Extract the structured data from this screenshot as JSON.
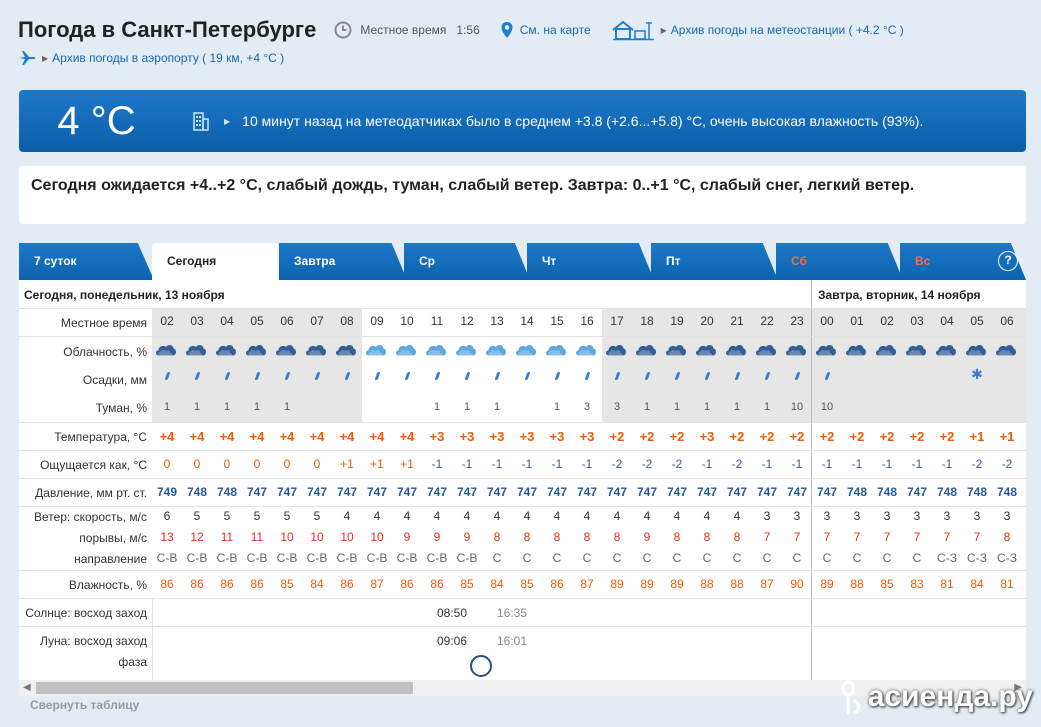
{
  "header": {
    "title": "Погода в Санкт-Петербурге",
    "local_time_label": "Местное время",
    "local_time": "1:56",
    "map_link": "См. на карте",
    "station_archive": "Архив погоды на метеостанции ( +4.2 °C )",
    "airport_archive": "Архив погоды в аэропорту ( 19 км, +4 °C )"
  },
  "now": {
    "temp": "4 °C",
    "message": "10 минут назад на метеодатчиках было в среднем +3.8 (+2.6...+5.8) °C, очень высокая влажность (93%)."
  },
  "forecast_text": "Сегодня ожидается +4..+2 °C, слабый дождь, туман, слабый ветер. Завтра: 0..+1 °C, слабый снег, легкий ветер.",
  "tabs": [
    {
      "label": "7 суток",
      "active": false,
      "weekend": false
    },
    {
      "label": "Сегодня",
      "active": true,
      "weekend": false
    },
    {
      "label": "Завтра",
      "active": false,
      "weekend": false
    },
    {
      "label": "Ср",
      "active": false,
      "weekend": false
    },
    {
      "label": "Чт",
      "active": false,
      "weekend": false
    },
    {
      "label": "Пт",
      "active": false,
      "weekend": false
    },
    {
      "label": "Сб",
      "active": false,
      "weekend": true
    },
    {
      "label": "Вс",
      "active": false,
      "weekend": true
    }
  ],
  "help_label": "?",
  "day_labels": {
    "today": "Сегодня, понедельник, 13 ноября",
    "tomorrow": "Завтра, вторник, 14 ноября"
  },
  "row_labels": {
    "time": "Местное время",
    "cloud": "Облачность, %",
    "precip": "Осадки, мм",
    "fog": "Туман, %",
    "temp": "Температура, °C",
    "feels": "Ощущается как, °C",
    "pressure": "Давление, мм рт. ст.",
    "wind_speed": "Ветер: скорость, м/с",
    "gusts": "порывы, м/с",
    "direction": "направление",
    "humidity": "Влажность, %",
    "sun": "Солнце:",
    "sun_rise": "восход",
    "sun_set": "заход",
    "moon": "Луна:",
    "moon_rise": "восход",
    "moon_set": "заход",
    "moon_phase": "фаза"
  },
  "hours": [
    "02",
    "03",
    "04",
    "05",
    "06",
    "07",
    "08",
    "09",
    "10",
    "11",
    "12",
    "13",
    "14",
    "15",
    "16",
    "17",
    "18",
    "19",
    "20",
    "21",
    "22",
    "23",
    "00",
    "01",
    "02",
    "03",
    "04",
    "05",
    "06"
  ],
  "fog": [
    "1",
    "1",
    "1",
    "1",
    "1",
    "",
    "",
    "",
    "",
    "1",
    "1",
    "1",
    "",
    "1",
    "3",
    "3",
    "1",
    "1",
    "1",
    "1",
    "1",
    "10",
    "10",
    "",
    "",
    "",
    "",
    "",
    ""
  ],
  "temp": [
    "+4",
    "+4",
    "+4",
    "+4",
    "+4",
    "+4",
    "+4",
    "+4",
    "+4",
    "+3",
    "+3",
    "+3",
    "+3",
    "+3",
    "+3",
    "+2",
    "+2",
    "+2",
    "+3",
    "+2",
    "+2",
    "+2",
    "+2",
    "+2",
    "+2",
    "+2",
    "+2",
    "+1",
    "+1"
  ],
  "feels": [
    "0",
    "0",
    "0",
    "0",
    "0",
    "0",
    "+1",
    "+1",
    "+1",
    "-1",
    "-1",
    "-1",
    "-1",
    "-1",
    "-1",
    "-2",
    "-2",
    "-2",
    "-1",
    "-2",
    "-1",
    "-1",
    "-1",
    "-1",
    "-1",
    "-1",
    "-1",
    "-2",
    "-2"
  ],
  "pressure": [
    "749",
    "748",
    "748",
    "747",
    "747",
    "747",
    "747",
    "747",
    "747",
    "747",
    "747",
    "747",
    "747",
    "747",
    "747",
    "747",
    "747",
    "747",
    "747",
    "747",
    "747",
    "747",
    "747",
    "748",
    "748",
    "747",
    "748",
    "748",
    "748"
  ],
  "wind": [
    "6",
    "5",
    "5",
    "5",
    "5",
    "5",
    "4",
    "4",
    "4",
    "4",
    "4",
    "4",
    "4",
    "4",
    "4",
    "4",
    "4",
    "4",
    "4",
    "4",
    "3",
    "3",
    "3",
    "3",
    "3",
    "3",
    "3",
    "3",
    "3"
  ],
  "gusts": [
    "13",
    "12",
    "11",
    "11",
    "10",
    "10",
    "10",
    "10",
    "9",
    "9",
    "9",
    "8",
    "8",
    "8",
    "8",
    "8",
    "9",
    "8",
    "8",
    "8",
    "7",
    "7",
    "7",
    "7",
    "7",
    "7",
    "7",
    "7",
    "8"
  ],
  "direction": [
    "С-В",
    "С-В",
    "С-В",
    "С-В",
    "С-В",
    "С-В",
    "С-В",
    "С-В",
    "С-В",
    "С-В",
    "С-В",
    "С",
    "С",
    "С",
    "С",
    "С",
    "С",
    "С",
    "С",
    "С",
    "С",
    "С",
    "С",
    "С",
    "С",
    "С",
    "С-З",
    "С-З",
    "С-З"
  ],
  "humidity": [
    "86",
    "86",
    "86",
    "86",
    "85",
    "84",
    "86",
    "87",
    "86",
    "86",
    "85",
    "84",
    "85",
    "86",
    "87",
    "89",
    "89",
    "89",
    "88",
    "88",
    "87",
    "90",
    "89",
    "88",
    "85",
    "83",
    "81",
    "84",
    "81"
  ],
  "sun": {
    "rise": "08:50",
    "set": "16:35"
  },
  "moon": {
    "rise": "09:06",
    "set": "16:01"
  },
  "collapse_label": "Свернуть таблицу",
  "watermark": "асиенда.ру",
  "colors": {
    "accent": "#0b5ea8",
    "warm": "#f05a00",
    "cold": "#355d9b",
    "gust": "#e0301e"
  }
}
